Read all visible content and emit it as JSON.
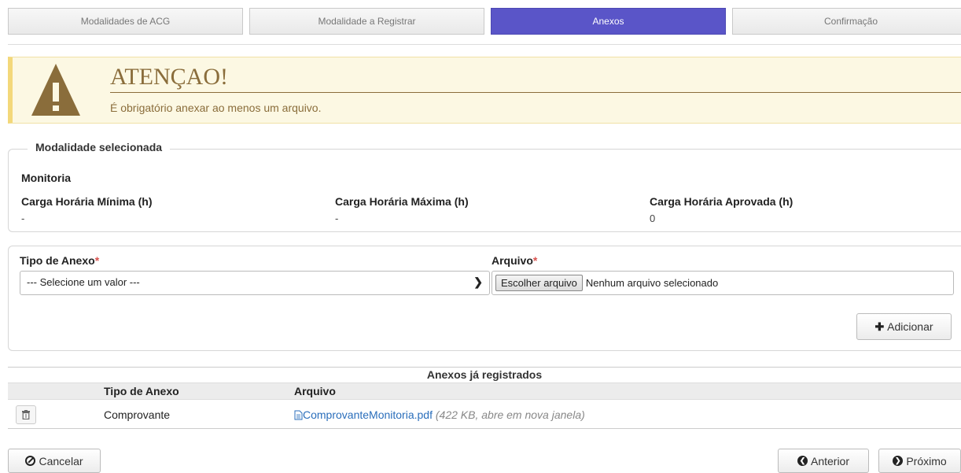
{
  "steps": [
    {
      "label": "Modalidades de ACG"
    },
    {
      "label": "Modalidade a Registrar"
    },
    {
      "label": "Anexos"
    },
    {
      "label": "Confirmação"
    }
  ],
  "alert": {
    "title": "ATENÇAO!",
    "message": "É obrigatório anexar ao menos um arquivo.",
    "icon": "warning-icon",
    "colors": {
      "background": "#fcf8e3",
      "text": "#8a6d3b"
    }
  },
  "modalidade": {
    "legend": "Modalidade selecionada",
    "name": "Monitoria",
    "carga_min_label": "Carga Horária Mínima (h)",
    "carga_min_value": "-",
    "carga_max_label": "Carga Horária Máxima (h)",
    "carga_max_value": "-",
    "carga_aprov_label": "Carga Horária Aprovada (h)",
    "carga_aprov_value": "0"
  },
  "form": {
    "tipo_label": "Tipo de Anexo",
    "arquivo_label": "Arquivo",
    "required_mark": "*",
    "tipo_selected": "--- Selecione um valor ---",
    "file_button": "Escolher arquivo",
    "file_status": "Nenhum arquivo selecionado",
    "add_button": "Adicionar"
  },
  "table": {
    "caption": "Anexos já registrados",
    "headers": [
      "Tipo de Anexo",
      "Arquivo"
    ],
    "rows": [
      {
        "tipo": "Comprovante",
        "arquivo": "ComprovanteMonitoria.pdf",
        "note": "(422 KB, abre em nova janela)"
      }
    ]
  },
  "buttons": {
    "cancel": "Cancelar",
    "previous": "Anterior",
    "next": "Próximo"
  },
  "accent_color": "#5a55c8"
}
